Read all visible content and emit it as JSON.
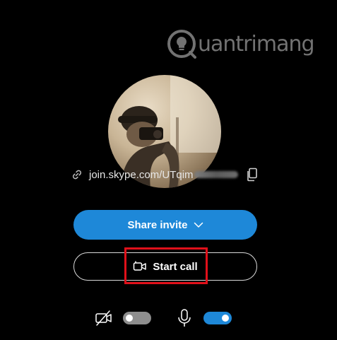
{
  "watermark": {
    "brand": "uantrimang",
    "logo_icon": "lightbulb-q-logo-icon"
  },
  "avatar": {
    "icon": "profile-photo"
  },
  "meeting_link": {
    "icon": "link-icon",
    "text": "join.skype.com/UTqim",
    "copy_icon": "copy-icon"
  },
  "share_invite": {
    "label": "Share invite",
    "icon": "chevron-down-icon"
  },
  "start_call": {
    "label": "Start call",
    "icon": "video-call-icon",
    "highlight_color": "#e0101a"
  },
  "media": {
    "camera": {
      "icon": "camera-off-icon",
      "enabled": false
    },
    "microphone": {
      "icon": "microphone-icon",
      "enabled": true
    }
  },
  "colors": {
    "background": "#000000",
    "accent": "#1e88d8",
    "toggle_off": "#8e8e8e"
  }
}
